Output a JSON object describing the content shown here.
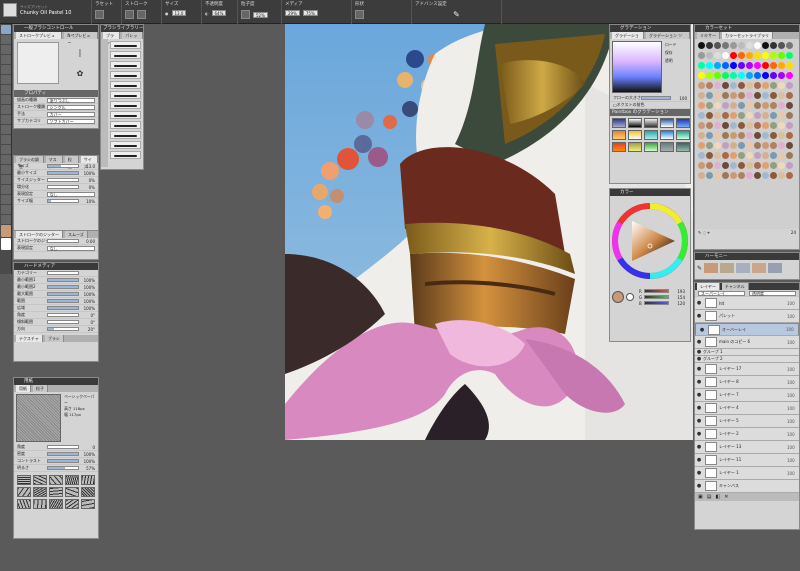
{
  "toolbar": {
    "brush_name": "Chunky Oil Pastel 10",
    "tool_label": "サイズプリセット",
    "groups": [
      "ラセット",
      "ストローク",
      "サイズ",
      "不透明度",
      "粒子度",
      "メディア",
      "形状",
      "アドバンス設定"
    ],
    "size_value": "13.0",
    "opacity_value": "64%",
    "grain_value": "52%",
    "media_a": "29%",
    "media_b": "75%"
  },
  "brush_control": {
    "title": "一般ブラシコントロール",
    "tabs": [
      "ストロークプレビュー",
      "Nペプレビュー"
    ],
    "properties_title": "プロパティ",
    "rows": [
      {
        "label": "描画の種類",
        "value": "塗りつぶし"
      },
      {
        "label": "ストローク種類",
        "value": "シングル"
      },
      {
        "label": "手法",
        "value": "カバー"
      },
      {
        "label": "サブカテゴリ",
        "value": "ソフトカバー"
      }
    ],
    "tabs2": [
      "ブラシの調整",
      "マスク",
      "粒度",
      "サイズ"
    ],
    "size_rows": [
      {
        "label": "サイズ",
        "value": "13.0",
        "pct": 45
      },
      {
        "label": "最小サイズ",
        "value": "100%",
        "pct": 100
      },
      {
        "label": "サイズジッター",
        "value": "0%",
        "pct": 0
      },
      {
        "label": "増分化",
        "value": "0%",
        "pct": 0
      }
    ],
    "expr_label": "表現設定",
    "expr_value": "なし",
    "size_step_label": "サイズ幅",
    "size_step_value": "10%"
  },
  "stroke_section": {
    "tabs": [
      "ストロークのジッター",
      "スムーズ"
    ],
    "rows": [
      {
        "label": "ストロークのジッター",
        "value": "0.00",
        "pct": 0
      }
    ],
    "expr_label": "表現設定",
    "expr_value": "なし"
  },
  "hard_media": {
    "title": "ハードメディア",
    "rows": [
      {
        "label": "カテゴリー",
        "value": "",
        "pct": 0
      },
      {
        "label": "最小範囲1",
        "value": "100%",
        "pct": 100
      },
      {
        "label": "最小範囲2",
        "value": "100%",
        "pct": 100
      },
      {
        "label": "最大範囲",
        "value": "100%",
        "pct": 100
      },
      {
        "label": "範囲",
        "value": "100%",
        "pct": 100
      },
      {
        "label": "広域",
        "value": "100%",
        "pct": 100
      },
      {
        "label": "角度",
        "value": "0°",
        "pct": 0
      },
      {
        "label": "傾斜範囲",
        "value": "0°",
        "pct": 0
      },
      {
        "label": "方向",
        "value": "20°",
        "pct": 20
      }
    ],
    "bottom_tabs": [
      "テクスチャ",
      "ブラシ"
    ]
  },
  "paper": {
    "title": "用紙",
    "tabs": [
      "用紙",
      "粒子"
    ],
    "paper_name": "ベーシックペーパー",
    "size_label": "高さ 118px",
    "size_label2": "幅 117px",
    "rows": [
      {
        "label": "角度",
        "value": "0",
        "pct": 0
      },
      {
        "label": "密度",
        "value": "100%",
        "pct": 100
      },
      {
        "label": "コントラスト",
        "value": "100%",
        "pct": 100
      },
      {
        "label": "明るさ",
        "value": "57%",
        "pct": 57
      }
    ]
  },
  "brush_library": {
    "title": "ブラシライブラリー",
    "tabs": [
      "ブラシ",
      "パレット"
    ]
  },
  "gradation": {
    "title": "グラデーション",
    "tabs": [
      "グラデーション",
      "グラデーション ソード"
    ],
    "option_rows": [
      "ロード",
      "保存",
      "透明"
    ],
    "value_label": "フローの大きさ",
    "value": "100",
    "section_label": "ネクストの前色",
    "grid_title": "Paintbox のグラデーション"
  },
  "color_panel": {
    "title": "カラー",
    "rgb_rows": [
      "R",
      "G",
      "B"
    ],
    "rgb_values": [
      "193",
      "154",
      "120"
    ],
    "accent": "#c89a78"
  },
  "color_set": {
    "title": "カラーセット",
    "tabs": [
      "ミキサー",
      "カラーセットライブラリ"
    ],
    "zoom": "24"
  },
  "harmony": {
    "title": "ハーモニー"
  },
  "layers": {
    "title": "レイヤー",
    "tabs": [
      "レイヤー",
      "チャンネル"
    ],
    "blend_mode": "スーパーレイ",
    "opacity_label": "透明度",
    "items": [
      {
        "name": "hlt",
        "pct": "100"
      },
      {
        "name": "パレット",
        "pct": "100"
      },
      {
        "name": "オーバーレイ",
        "pct": "100",
        "selected": true
      },
      {
        "name": "main のコピー 6",
        "pct": "100"
      },
      {
        "name": "グループ 1",
        "pct": ""
      },
      {
        "name": "グループ 2",
        "pct": ""
      },
      {
        "name": "レイヤー 17",
        "pct": "100"
      },
      {
        "name": "レイヤー 8",
        "pct": "100"
      },
      {
        "name": "レイヤー 7",
        "pct": "100"
      },
      {
        "name": "レイヤー 4",
        "pct": "100"
      },
      {
        "name": "レイヤー 5",
        "pct": "100"
      },
      {
        "name": "レイヤー 2",
        "pct": "100"
      },
      {
        "name": "レイヤー 13",
        "pct": "100"
      },
      {
        "name": "レイヤー 11",
        "pct": "100"
      },
      {
        "name": "レイヤー 1",
        "pct": "100"
      },
      {
        "name": "キャンバス",
        "pct": ""
      }
    ]
  }
}
